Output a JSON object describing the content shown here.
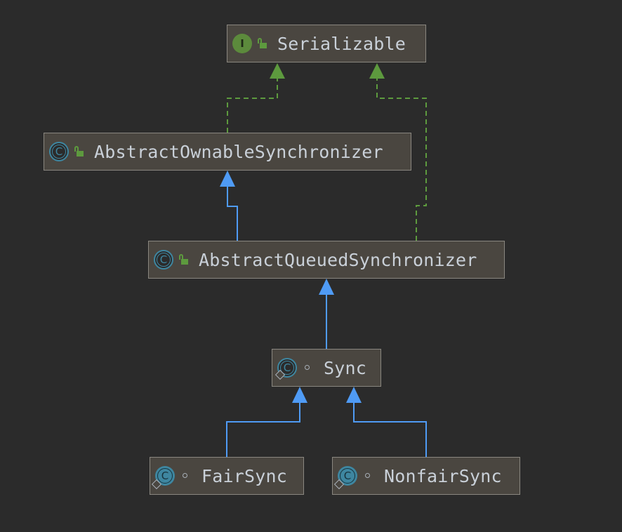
{
  "colors": {
    "background": "#2b2b2b",
    "node_fill": "#4a4640",
    "node_border": "#8a8780",
    "implements_edge": "#5d9a3e",
    "extends_edge": "#4f9bf5",
    "text": "#c9d0d8"
  },
  "legend_icons": {
    "interface": "interface-icon",
    "class": "class-icon",
    "abstract_class": "abstract-class-icon",
    "public": "public-lock-icon",
    "package_private": "package-private-dot-icon"
  },
  "nodes": [
    {
      "id": "serializable",
      "label": "Serializable",
      "kind": "interface",
      "icon_letter": "I",
      "access": "public"
    },
    {
      "id": "aos",
      "label": "AbstractOwnableSynchronizer",
      "kind": "abstract-class",
      "icon_letter": "C",
      "access": "public"
    },
    {
      "id": "aqs",
      "label": "AbstractQueuedSynchronizer",
      "kind": "abstract-class",
      "icon_letter": "C",
      "access": "public"
    },
    {
      "id": "sync",
      "label": "Sync",
      "kind": "static-abstract-class",
      "icon_letter": "C",
      "access": "package"
    },
    {
      "id": "fair",
      "label": "FairSync",
      "kind": "static-class",
      "icon_letter": "C",
      "access": "package"
    },
    {
      "id": "nonfair",
      "label": "NonfairSync",
      "kind": "static-class",
      "icon_letter": "C",
      "access": "package"
    }
  ],
  "edges": [
    {
      "from": "aos",
      "to": "serializable",
      "type": "implements"
    },
    {
      "from": "aqs",
      "to": "serializable",
      "type": "implements"
    },
    {
      "from": "aqs",
      "to": "aos",
      "type": "extends"
    },
    {
      "from": "sync",
      "to": "aqs",
      "type": "extends"
    },
    {
      "from": "fair",
      "to": "sync",
      "type": "extends"
    },
    {
      "from": "nonfair",
      "to": "sync",
      "type": "extends"
    }
  ]
}
